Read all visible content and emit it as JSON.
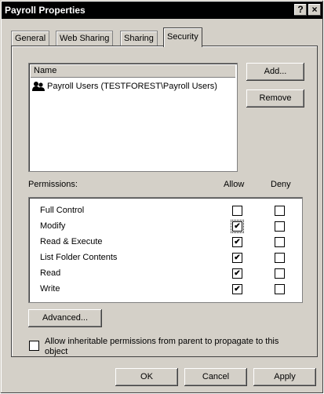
{
  "window": {
    "title": "Payroll Properties",
    "help_glyph": "?",
    "close_glyph": "×"
  },
  "tabs": [
    {
      "label": "General"
    },
    {
      "label": "Web Sharing"
    },
    {
      "label": "Sharing"
    },
    {
      "label": "Security",
      "active": true
    }
  ],
  "names": {
    "header": "Name",
    "items": [
      {
        "label": "Payroll Users (TESTFOREST\\Payroll Users)",
        "icon": "users-group-icon"
      }
    ]
  },
  "buttons": {
    "add": "Add...",
    "remove": "Remove",
    "advanced": "Advanced...",
    "ok": "OK",
    "cancel": "Cancel",
    "apply": "Apply"
  },
  "permissions": {
    "label": "Permissions:",
    "allow_header": "Allow",
    "deny_header": "Deny",
    "rows": [
      {
        "name": "Full Control",
        "allow": false,
        "deny": false
      },
      {
        "name": "Modify",
        "allow": true,
        "deny": false,
        "focused": true
      },
      {
        "name": "Read & Execute",
        "allow": true,
        "deny": false
      },
      {
        "name": "List Folder Contents",
        "allow": true,
        "deny": false
      },
      {
        "name": "Read",
        "allow": true,
        "deny": false
      },
      {
        "name": "Write",
        "allow": true,
        "deny": false
      }
    ]
  },
  "inherit": {
    "label": "Allow inheritable permissions from parent to propagate to this object",
    "checked": false
  }
}
